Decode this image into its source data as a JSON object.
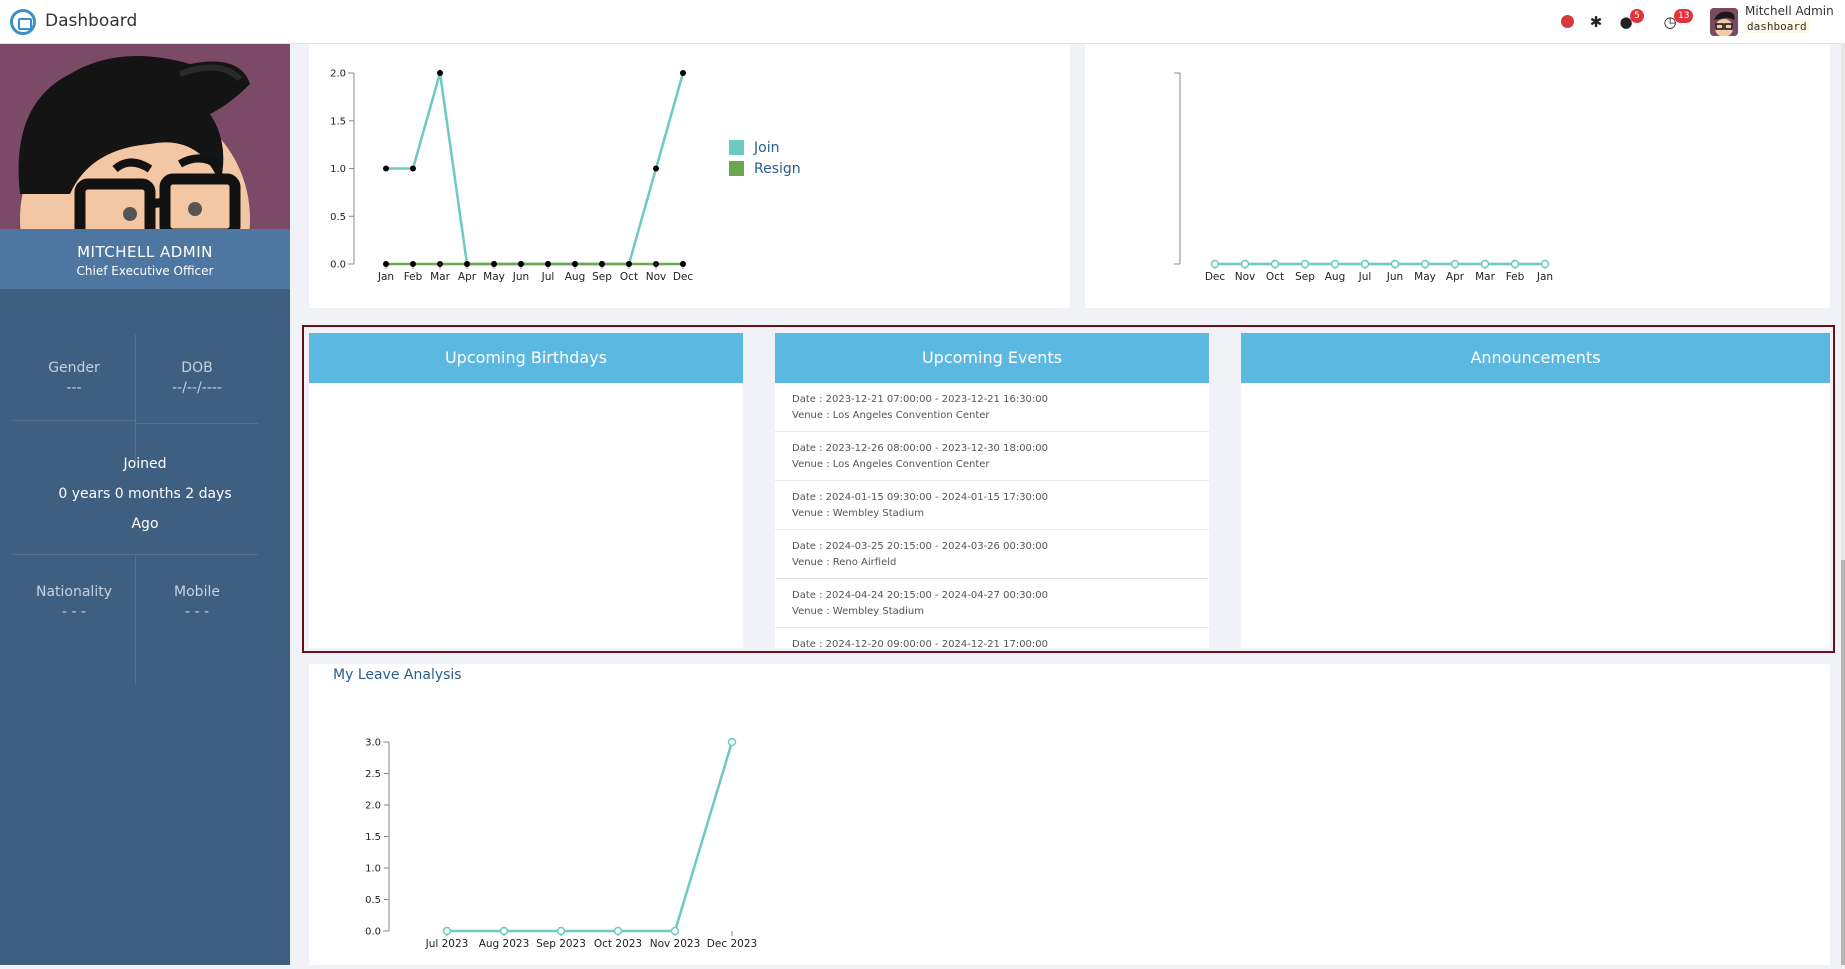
{
  "navbar": {
    "title": "Dashboard",
    "messages_badge": "5",
    "activities_badge": "13",
    "user_name": "Mitchell Admin",
    "database": "dashboard",
    "icons": [
      "recording-dot-icon",
      "bug-icon",
      "chat-icon",
      "clock-icon"
    ]
  },
  "sidebar": {
    "name": "MITCHELL ADMIN",
    "job": "Chief Executive Officer",
    "gender_label": "Gender",
    "gender_value": "---",
    "dob_label": "DOB",
    "dob_value": "--/--/----",
    "joined_label": "Joined",
    "joined_duration": "0 years 0 months 2 days",
    "joined_suffix": "Ago",
    "nationality_label": "Nationality",
    "nationality_value": "- - -",
    "mobile_label": "Mobile",
    "mobile_value": "- - -"
  },
  "birthdays": {
    "title": "Upcoming Birthdays"
  },
  "events": {
    "title": "Upcoming Events",
    "items": [
      {
        "date": "Date : 2023-12-21 07:00:00 - 2023-12-21 16:30:00",
        "venue": "Venue : Los Angeles Convention Center"
      },
      {
        "date": "Date : 2023-12-26 08:00:00 - 2023-12-30 18:00:00",
        "venue": "Venue : Los Angeles Convention Center"
      },
      {
        "date": "Date : 2024-01-15 09:30:00 - 2024-01-15 17:30:00",
        "venue": "Venue : Wembley Stadium"
      },
      {
        "date": "Date : 2024-03-25 20:15:00 - 2024-03-26 00:30:00",
        "venue": "Venue : Reno Airfield"
      },
      {
        "date": "Date : 2024-04-24 20:15:00 - 2024-04-27 00:30:00",
        "venue": "Venue : Wembley Stadium"
      },
      {
        "date": "Date : 2024-12-20 09:00:00 - 2024-12-21 17:00:00",
        "venue": ""
      }
    ]
  },
  "announcements": {
    "title": "Announcements"
  },
  "leave": {
    "title": "My Leave Analysis"
  },
  "chart_data": [
    {
      "type": "line",
      "categories": [
        "Jan",
        "Feb",
        "Mar",
        "Apr",
        "May",
        "Jun",
        "Jul",
        "Aug",
        "Sep",
        "Oct",
        "Nov",
        "Dec"
      ],
      "series": [
        {
          "name": "Join",
          "color": "#6ccac0",
          "values": [
            1,
            1,
            2,
            0,
            0,
            0,
            0,
            0,
            0,
            0,
            1,
            2
          ]
        },
        {
          "name": "Resign",
          "color": "#6aa84f",
          "values": [
            0,
            0,
            0,
            0,
            0,
            0,
            0,
            0,
            0,
            0,
            0,
            0
          ]
        }
      ],
      "yticks": [
        "0.0",
        "0.5",
        "1.0",
        "1.5",
        "2.0"
      ],
      "ylim": [
        0,
        2
      ],
      "legend": "right"
    },
    {
      "type": "line",
      "categories": [
        "Dec",
        "Nov",
        "Oct",
        "Sep",
        "Aug",
        "Jul",
        "Jun",
        "May",
        "Apr",
        "Mar",
        "Feb",
        "Jan"
      ],
      "series": [
        {
          "color": "#6ccac0",
          "values": [
            0,
            0,
            0,
            0,
            0,
            0,
            0,
            0,
            0,
            0,
            0,
            0
          ]
        }
      ],
      "ylim": [
        0,
        1
      ]
    },
    {
      "type": "line",
      "categories": [
        "Jul 2023",
        "Aug 2023",
        "Sep 2023",
        "Oct 2023",
        "Nov 2023",
        "Dec 2023"
      ],
      "series": [
        {
          "color": "#6ccac0",
          "values": [
            0,
            0,
            0,
            0,
            0,
            3
          ]
        }
      ],
      "yticks": [
        "0.0",
        "0.5",
        "1.0",
        "1.5",
        "2.0",
        "2.5",
        "3.0"
      ],
      "ylim": [
        0,
        3
      ]
    }
  ]
}
